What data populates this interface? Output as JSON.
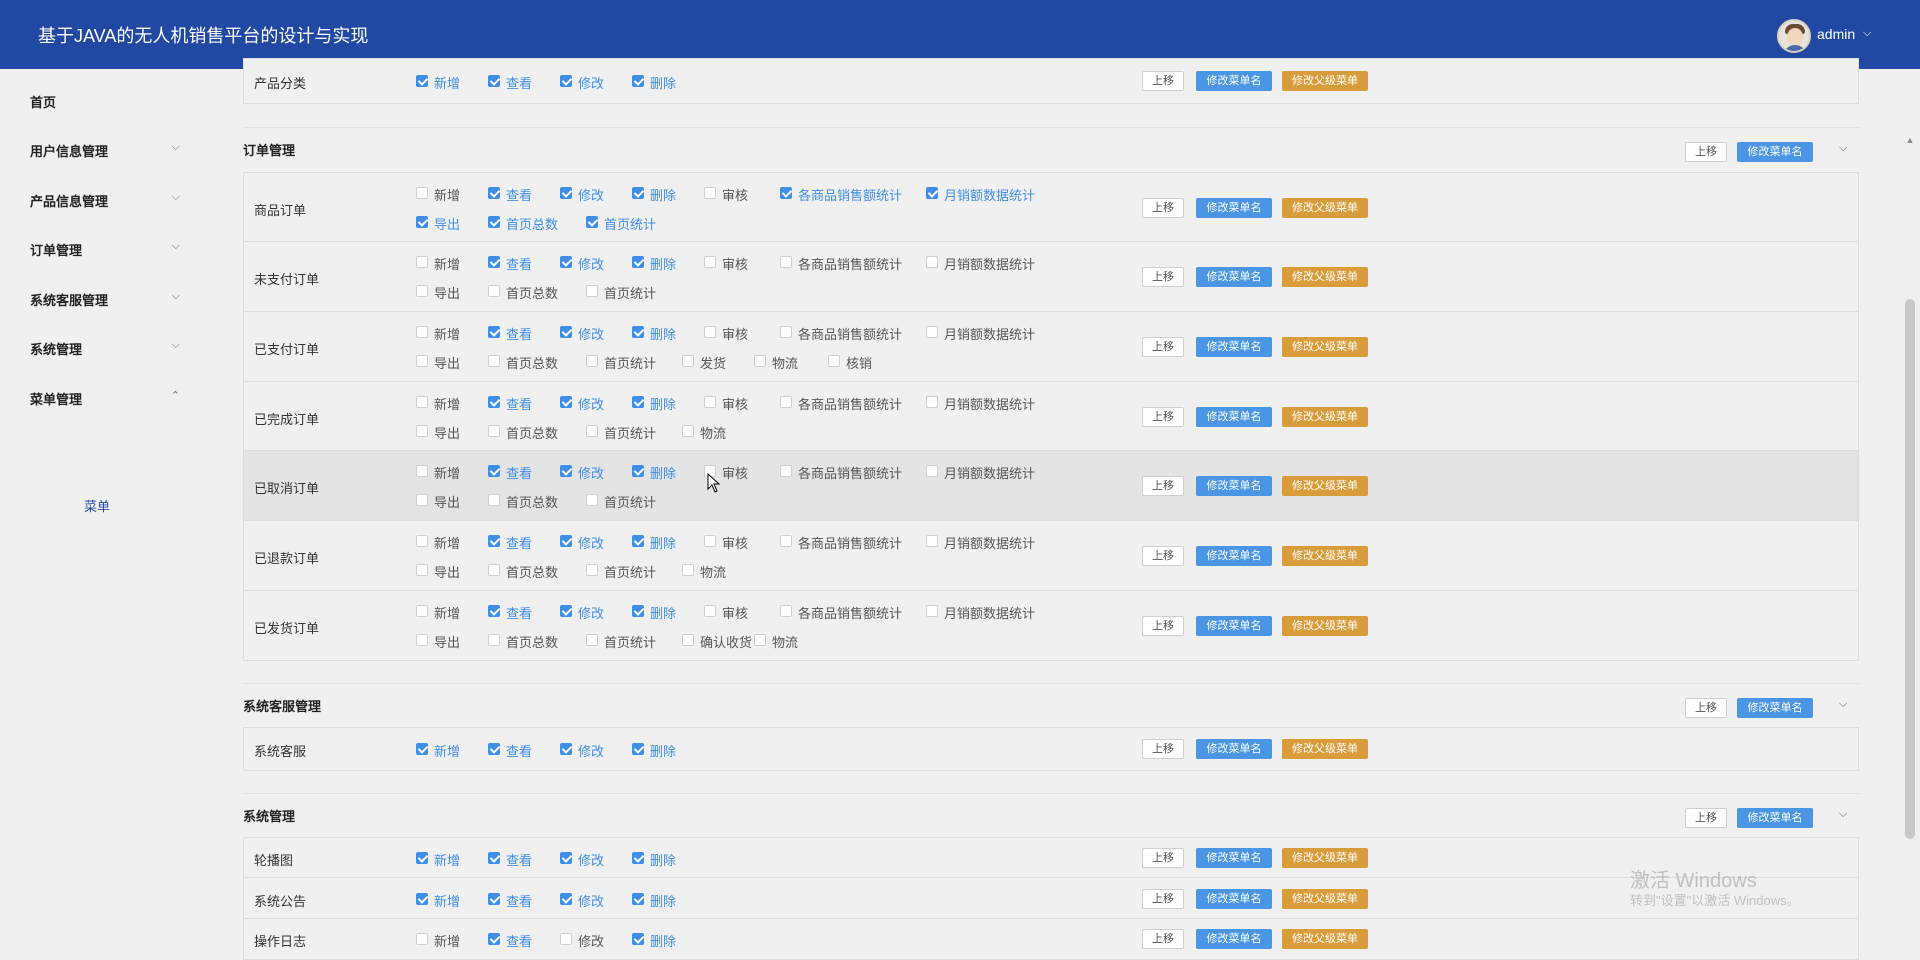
{
  "app": {
    "title": "基于JAVA的无人机销售平台的设计与实现",
    "user": "admin"
  },
  "sidebar": {
    "items": [
      {
        "label": "首页"
      },
      {
        "label": "用户信息管理"
      },
      {
        "label": "产品信息管理"
      },
      {
        "label": "订单管理"
      },
      {
        "label": "系统客服管理"
      },
      {
        "label": "系统管理"
      },
      {
        "label": "菜单管理"
      }
    ],
    "sub_item": "菜单"
  },
  "buttons": {
    "up": "上移",
    "rename": "修改菜单名",
    "parent": "修改父级菜单"
  },
  "groups": {
    "product": {
      "rows": [
        {
          "name": "产品分类",
          "perms": [
            {
              "label": "新增",
              "checked": true
            },
            {
              "label": "查看",
              "checked": true
            },
            {
              "label": "修改",
              "checked": true
            },
            {
              "label": "删除",
              "checked": true
            }
          ]
        }
      ]
    },
    "order": {
      "title": "订单管理",
      "rows": [
        {
          "name": "商品订单",
          "perms": [
            {
              "label": "新增",
              "checked": false
            },
            {
              "label": "查看",
              "checked": true
            },
            {
              "label": "修改",
              "checked": true
            },
            {
              "label": "删除",
              "checked": true
            },
            {
              "label": "审核",
              "checked": false
            },
            {
              "label": "各商品销售额统计",
              "checked": true
            },
            {
              "label": "月销额数据统计",
              "checked": true
            },
            {
              "label": "导出",
              "checked": true
            },
            {
              "label": "首页总数",
              "checked": true
            },
            {
              "label": "首页统计",
              "checked": true
            }
          ]
        },
        {
          "name": "未支付订单",
          "perms": [
            {
              "label": "新增",
              "checked": false
            },
            {
              "label": "查看",
              "checked": true
            },
            {
              "label": "修改",
              "checked": true
            },
            {
              "label": "删除",
              "checked": true
            },
            {
              "label": "审核",
              "checked": false
            },
            {
              "label": "各商品销售额统计",
              "checked": false
            },
            {
              "label": "月销额数据统计",
              "checked": false
            },
            {
              "label": "导出",
              "checked": false
            },
            {
              "label": "首页总数",
              "checked": false
            },
            {
              "label": "首页统计",
              "checked": false
            }
          ]
        },
        {
          "name": "已支付订单",
          "perms": [
            {
              "label": "新增",
              "checked": false
            },
            {
              "label": "查看",
              "checked": true
            },
            {
              "label": "修改",
              "checked": true
            },
            {
              "label": "删除",
              "checked": true
            },
            {
              "label": "审核",
              "checked": false
            },
            {
              "label": "各商品销售额统计",
              "checked": false
            },
            {
              "label": "月销额数据统计",
              "checked": false
            },
            {
              "label": "导出",
              "checked": false
            },
            {
              "label": "首页总数",
              "checked": false
            },
            {
              "label": "首页统计",
              "checked": false
            },
            {
              "label": "发货",
              "checked": false
            },
            {
              "label": "物流",
              "checked": false
            },
            {
              "label": "核销",
              "checked": false
            }
          ]
        },
        {
          "name": "已完成订单",
          "perms": [
            {
              "label": "新增",
              "checked": false
            },
            {
              "label": "查看",
              "checked": true
            },
            {
              "label": "修改",
              "checked": true
            },
            {
              "label": "删除",
              "checked": true
            },
            {
              "label": "审核",
              "checked": false
            },
            {
              "label": "各商品销售额统计",
              "checked": false
            },
            {
              "label": "月销额数据统计",
              "checked": false
            },
            {
              "label": "导出",
              "checked": false
            },
            {
              "label": "首页总数",
              "checked": false
            },
            {
              "label": "首页统计",
              "checked": false
            },
            {
              "label": "物流",
              "checked": false
            }
          ]
        },
        {
          "name": "已取消订单",
          "perms": [
            {
              "label": "新增",
              "checked": false
            },
            {
              "label": "查看",
              "checked": true
            },
            {
              "label": "修改",
              "checked": true
            },
            {
              "label": "删除",
              "checked": true
            },
            {
              "label": "审核",
              "checked": false
            },
            {
              "label": "各商品销售额统计",
              "checked": false
            },
            {
              "label": "月销额数据统计",
              "checked": false
            },
            {
              "label": "导出",
              "checked": false
            },
            {
              "label": "首页总数",
              "checked": false
            },
            {
              "label": "首页统计",
              "checked": false
            }
          ]
        },
        {
          "name": "已退款订单",
          "perms": [
            {
              "label": "新增",
              "checked": false
            },
            {
              "label": "查看",
              "checked": true
            },
            {
              "label": "修改",
              "checked": true
            },
            {
              "label": "删除",
              "checked": true
            },
            {
              "label": "审核",
              "checked": false
            },
            {
              "label": "各商品销售额统计",
              "checked": false
            },
            {
              "label": "月销额数据统计",
              "checked": false
            },
            {
              "label": "导出",
              "checked": false
            },
            {
              "label": "首页总数",
              "checked": false
            },
            {
              "label": "首页统计",
              "checked": false
            },
            {
              "label": "物流",
              "checked": false
            }
          ]
        },
        {
          "name": "已发货订单",
          "perms": [
            {
              "label": "新增",
              "checked": false
            },
            {
              "label": "查看",
              "checked": true
            },
            {
              "label": "修改",
              "checked": true
            },
            {
              "label": "删除",
              "checked": true
            },
            {
              "label": "审核",
              "checked": false
            },
            {
              "label": "各商品销售额统计",
              "checked": false
            },
            {
              "label": "月销额数据统计",
              "checked": false
            },
            {
              "label": "导出",
              "checked": false
            },
            {
              "label": "首页总数",
              "checked": false
            },
            {
              "label": "首页统计",
              "checked": false
            },
            {
              "label": "确认收货",
              "checked": false
            },
            {
              "label": "物流",
              "checked": false
            }
          ]
        }
      ]
    },
    "service": {
      "title": "系统客服管理",
      "rows": [
        {
          "name": "系统客服",
          "perms": [
            {
              "label": "新增",
              "checked": true
            },
            {
              "label": "查看",
              "checked": true
            },
            {
              "label": "修改",
              "checked": true
            },
            {
              "label": "删除",
              "checked": true
            }
          ]
        }
      ]
    },
    "system": {
      "title": "系统管理",
      "rows": [
        {
          "name": "轮播图",
          "perms": [
            {
              "label": "新增",
              "checked": true
            },
            {
              "label": "查看",
              "checked": true
            },
            {
              "label": "修改",
              "checked": true
            },
            {
              "label": "删除",
              "checked": true
            }
          ]
        },
        {
          "name": "系统公告",
          "perms": [
            {
              "label": "新增",
              "checked": true
            },
            {
              "label": "查看",
              "checked": true
            },
            {
              "label": "修改",
              "checked": true
            },
            {
              "label": "删除",
              "checked": true
            }
          ]
        },
        {
          "name": "操作日志",
          "perms": [
            {
              "label": "新增",
              "checked": false
            },
            {
              "label": "查看",
              "checked": true
            },
            {
              "label": "修改",
              "checked": false
            },
            {
              "label": "删除",
              "checked": true
            }
          ]
        }
      ]
    }
  },
  "watermark": {
    "line1": "激活 Windows",
    "line2": "转到\"设置\"以激活 Windows。"
  },
  "colors": {
    "header": "#2149a4",
    "checked": "#3f8ee8",
    "rename_btn": "#4a95e4",
    "parent_btn": "#d99c3b"
  }
}
